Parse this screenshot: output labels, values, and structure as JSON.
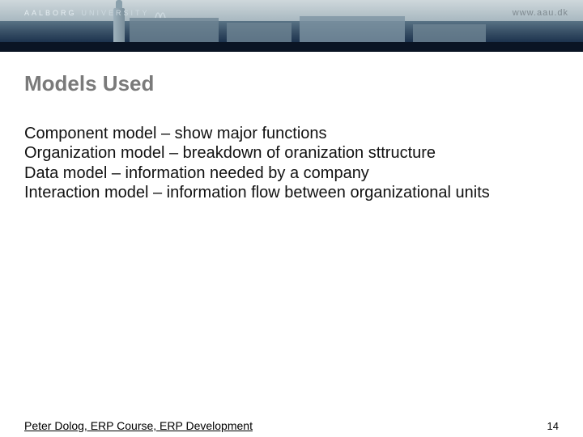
{
  "header": {
    "logo_text_bold": "AALBORG",
    "logo_text_light": "UNIVERSITY",
    "url": "www.aau.dk"
  },
  "title": "Models Used",
  "bullets": [
    "Component model – show major functions",
    "Organization model – breakdown of oranization sttructure",
    "Data model – information needed by a company",
    "Interaction model – information flow between organizational units"
  ],
  "footer": {
    "author": "Peter Dolog, ERP Course, ERP Development",
    "page": "14"
  }
}
